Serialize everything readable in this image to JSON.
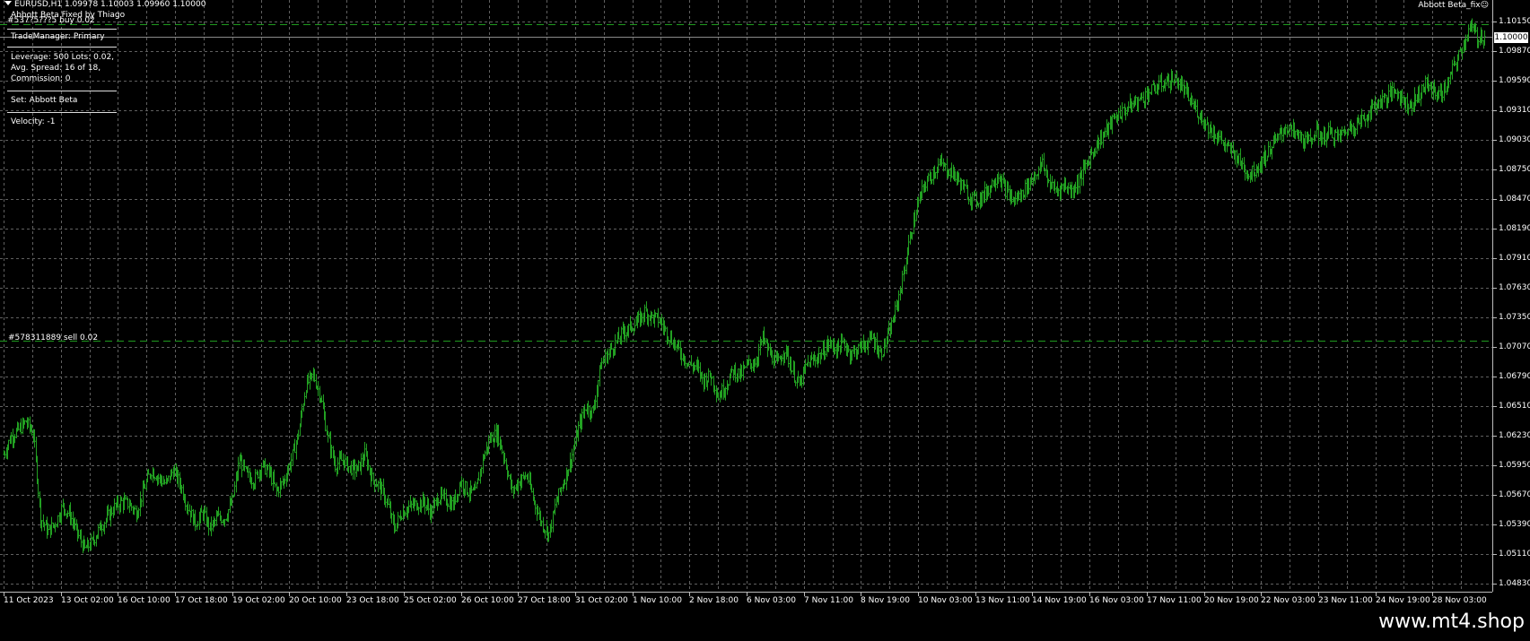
{
  "header": {
    "symbol_info": "EURUSD,H1  1.09978 1.10003 1.09960 1.10000",
    "ea_name": "Abbott Beta_fix",
    "ea_status_icon": "smiley-icon"
  },
  "info_panel": {
    "title": "Abbott Beta Fixed by Thiago",
    "order_overlay": "#537?5???5 buy 0.02",
    "trade_manager": "TradeManager: Primary",
    "account_line1": "Leverage: 500 Lots: 0.02,",
    "account_line2": "Avg. Spread: 16 of 18,",
    "account_line3": "Commission: 0",
    "set_name": "Set: Abbott Beta",
    "velocity": "Velocity: -1"
  },
  "orders": {
    "sell_label": "#578311889 sell 0.02"
  },
  "current_price": "1.10000",
  "colors": {
    "background": "#000000",
    "candles": "#22a022",
    "grid": "#606060",
    "order_line": "#1f9a1f"
  },
  "footer": {
    "url": "www.mt4.shop"
  },
  "chart_data": {
    "type": "line",
    "symbol": "EURUSD",
    "timeframe": "H1",
    "ylim": [
      1.0475,
      1.1035
    ],
    "y_ticks": [
      "1.10150",
      "1.09870",
      "1.09590",
      "1.09310",
      "1.09030",
      "1.08750",
      "1.08470",
      "1.08190",
      "1.07910",
      "1.07630",
      "1.07350",
      "1.07070",
      "1.06790",
      "1.06510",
      "1.06230",
      "1.05950",
      "1.05670",
      "1.05390",
      "1.05110",
      "1.04830"
    ],
    "x_ticks": [
      "11 Oct 2023",
      "13 Oct 02:00",
      "16 Oct 10:00",
      "17 Oct 18:00",
      "19 Oct 02:00",
      "20 Oct 10:00",
      "23 Oct 18:00",
      "25 Oct 02:00",
      "26 Oct 10:00",
      "27 Oct 18:00",
      "31 Oct 02:00",
      "1 Nov 10:00",
      "2 Nov 18:00",
      "6 Nov 03:00",
      "7 Nov 11:00",
      "8 Nov 19:00",
      "10 Nov 03:00",
      "13 Nov 11:00",
      "14 Nov 19:00",
      "16 Nov 03:00",
      "17 Nov 11:00",
      "20 Nov 19:00",
      "22 Nov 03:00",
      "23 Nov 11:00",
      "24 Nov 19:00",
      "28 Nov 03:00"
    ],
    "grid": true,
    "order_levels": [
      {
        "type": "buy",
        "price": 1.1012
      },
      {
        "type": "sell",
        "price": 1.0713
      }
    ],
    "series": [
      {
        "values": [
          1.0605,
          1.0622,
          1.0628,
          1.0636,
          1.0625,
          1.0545,
          1.0532,
          1.054,
          1.0556,
          1.0547,
          1.053,
          1.0515,
          1.0522,
          1.0535,
          1.0545,
          1.0555,
          1.056,
          1.0558,
          1.055,
          1.0572,
          1.059,
          1.0583,
          1.0577,
          1.059,
          1.0576,
          1.0555,
          1.054,
          1.055,
          1.0535,
          1.0545,
          1.0545,
          1.056,
          1.06,
          1.0585,
          1.058,
          1.0595,
          1.0588,
          1.057,
          1.058,
          1.06,
          1.0625,
          1.067,
          1.068,
          1.066,
          1.062,
          1.0595,
          1.06,
          1.0592,
          1.059,
          1.0605,
          1.0582,
          1.0575,
          1.056,
          1.0535,
          1.055,
          1.0555,
          1.0558,
          1.056,
          1.055,
          1.0565,
          1.0562,
          1.0557,
          1.058,
          1.057,
          1.0568,
          1.06,
          1.062,
          1.0625,
          1.06,
          1.057,
          1.058,
          1.0585,
          1.056,
          1.054,
          1.053,
          1.056,
          1.058,
          1.06,
          1.063,
          1.065,
          1.0645,
          1.069,
          1.07,
          1.071,
          1.072,
          1.0725,
          1.073,
          1.074,
          1.0735,
          1.0732,
          1.072,
          1.071,
          1.07,
          1.069,
          1.0688,
          1.0675,
          1.068,
          1.066,
          1.067,
          1.0685,
          1.068,
          1.069,
          1.0692,
          1.0715,
          1.07,
          1.069,
          1.0705,
          1.0685,
          1.067,
          1.069,
          1.0695,
          1.07,
          1.071,
          1.0705,
          1.071,
          1.07,
          1.0705,
          1.071,
          1.0715,
          1.07,
          1.0715,
          1.074,
          1.077,
          1.081,
          1.084,
          1.086,
          1.087,
          1.088,
          1.0875,
          1.087,
          1.086,
          1.085,
          1.0845,
          1.085,
          1.086,
          1.087,
          1.0855,
          1.0845,
          1.085,
          1.086,
          1.087,
          1.088,
          1.086,
          1.0855,
          1.086,
          1.0855,
          1.0865,
          1.088,
          1.0895,
          1.0905,
          1.0915,
          1.0925,
          1.093,
          1.0935,
          1.094,
          1.0945,
          1.095,
          1.0955,
          1.0958,
          1.096,
          1.0952,
          1.094,
          1.093,
          1.092,
          1.091,
          1.0905,
          1.0895,
          1.089,
          1.088,
          1.087,
          1.0875,
          1.0885,
          1.0895,
          1.0905,
          1.0915,
          1.091,
          1.0905,
          1.09,
          1.091,
          1.0905,
          1.091,
          1.0905,
          1.091,
          1.0915,
          1.092,
          1.0925,
          1.0935,
          1.094,
          1.0945,
          1.095,
          1.094,
          1.0935,
          1.0945,
          1.0955,
          1.095,
          1.0945,
          1.0955,
          1.0975,
          1.099,
          1.101,
          1.1,
          1.1
        ]
      }
    ]
  }
}
